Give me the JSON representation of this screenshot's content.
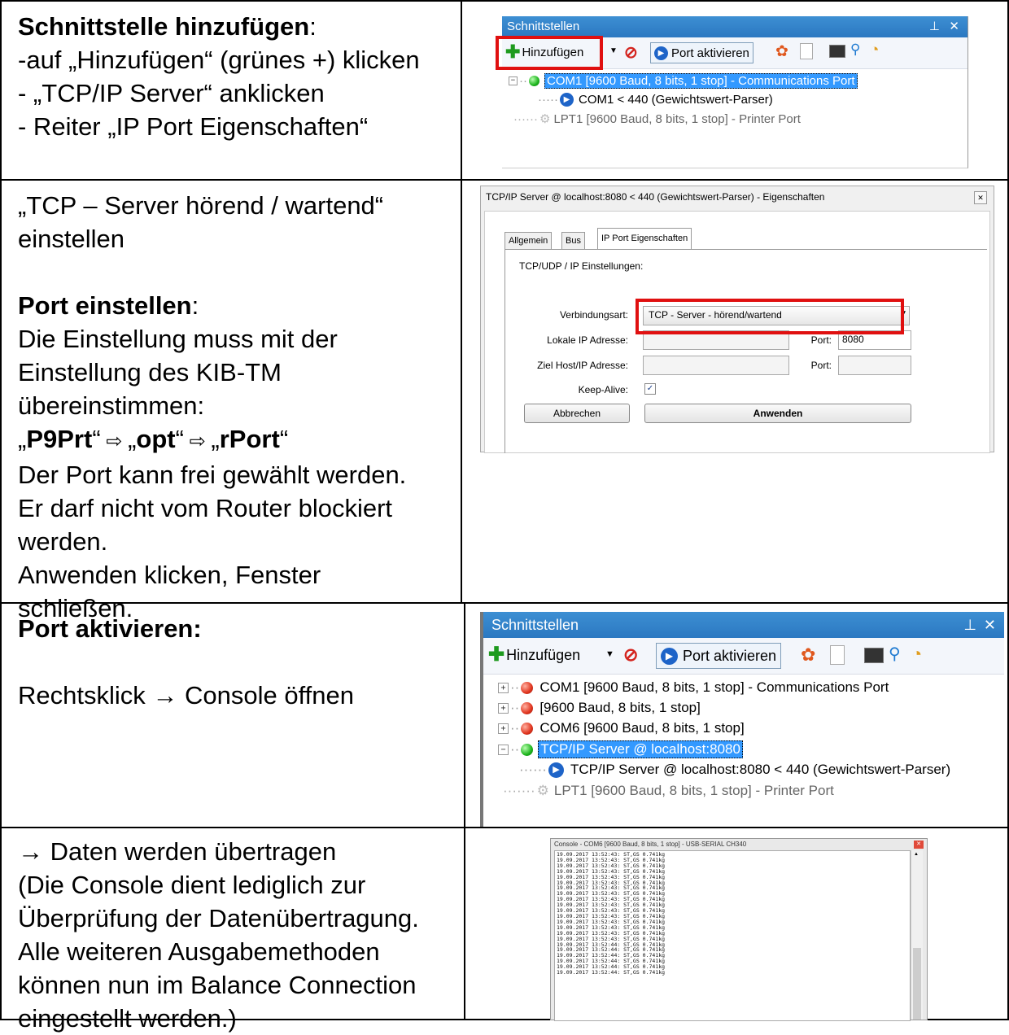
{
  "rows": {
    "r1": {
      "title": "Schnittstelle hinzufügen",
      "title_suffix": ":",
      "lines": [
        "-auf „Hinzufügen“ (grünes +) klicken",
        "- „TCP/IP Server“ anklicken",
        "- Reiter „IP Port Eigenschaften“"
      ]
    },
    "r2": {
      "intro1": "„TCP – Server hörend / wartend“",
      "intro2": "einstellen",
      "title": "Port einstellen",
      "title_suffix": ":",
      "p1": "Die Einstellung muss mit der",
      "p2": "Einstellung des KIB-TM",
      "p3": "übereinstimmen:",
      "path": {
        "a": "P9Prt",
        "b": "opt",
        "c": "rPort",
        "q_open": "„",
        "q_close": "“",
        "arrow": " ⇨ "
      },
      "p4": "Der Port kann frei gewählt werden.",
      "p5": "Er darf nicht vom Router blockiert",
      "p6": "werden.",
      "p7": "Anwenden klicken, Fenster",
      "p8": "schließen."
    },
    "r3": {
      "title": "Port aktivieren:",
      "line": "Rechtsklick → Console öffnen"
    },
    "r4": {
      "lines": [
        "→ Daten werden übertragen",
        "(Die Console dient lediglich zur",
        "Überprüfung der Datenübertragung.",
        "Alle weiteren Ausgabemethoden",
        "können nun im Balance Connection",
        "eingestellt werden.)"
      ]
    }
  },
  "panel1": {
    "title": "Schnittstellen",
    "pin": "ᵖ",
    "close": "✕",
    "add": "Hinzufügen",
    "activate": "Port aktivieren",
    "tree": [
      "COM1 [9600 Baud, 8 bits, 1 stop] - Communications Port",
      "COM1 < 440 (Gewichtswert-Parser)",
      "LPT1 [9600 Baud, 8 bits, 1 stop] - Printer Port"
    ]
  },
  "dialog": {
    "title": "TCP/IP Server @ localhost:8080 < 440 (Gewichtswert-Parser) - Eigenschaften",
    "tabs": [
      "Allgemein",
      "Bus",
      "IP Port Eigenschaften"
    ],
    "section": "TCP/UDP / IP Einstellungen:",
    "conn_label": "Verbindungsart:",
    "conn_value": "TCP - Server - hörend/wartend",
    "local_ip_label": "Lokale IP Adresse:",
    "port_label": "Port:",
    "port_value": "8080",
    "target_label": "Ziel Host/IP Adresse:",
    "keepalive_label": "Keep-Alive:",
    "check": "✓",
    "cancel": "Abbrechen",
    "apply": "Anwenden"
  },
  "panel2": {
    "title": "Schnittstellen",
    "pin": "ᵖ",
    "close": "✕",
    "add": "Hinzufügen",
    "activate": "Port aktivieren",
    "tree": [
      "COM1 [9600 Baud, 8 bits, 1 stop] - Communications Port",
      "[9600 Baud, 8 bits, 1 stop]",
      "COM6 [9600 Baud, 8 bits, 1 stop]",
      "TCP/IP Server @ localhost:8080",
      "TCP/IP Server @ localhost:8080 < 440 (Gewichtswert-Parser)",
      "LPT1 [9600 Baud, 8 bits, 1 stop] - Printer Port"
    ]
  },
  "console": {
    "title": "Console - COM6 [9600 Baud, 8 bits, 1 stop] - USB-SERIAL CH340",
    "lines": [
      "19.09.2017 13:52:43: ST,GS 0.741kg",
      "19.09.2017 13:52:43: ST,GS 0.741kg",
      "19.09.2017 13:52:43: ST,GS 0.741kg",
      "19.09.2017 13:52:43: ST,GS 0.741kg",
      "19.09.2017 13:52:43: ST,GS 0.741kg",
      "19.09.2017 13:52:43: ST,GS 0.741kg",
      "19.09.2017 13:52:43: ST,GS 0.741kg",
      "19.09.2017 13:52:43: ST,GS 0.741kg",
      "19.09.2017 13:52:43: ST,GS 0.741kg",
      "19.09.2017 13:52:43: ST,GS 0.741kg",
      "19.09.2017 13:52:43: ST,GS 0.741kg",
      "19.09.2017 13:52:43: ST,GS 0.741kg",
      "19.09.2017 13:52:43: ST,GS 0.741kg",
      "19.09.2017 13:52:43: ST,GS 0.741kg",
      "19.09.2017 13:52:43: ST,GS 0.741kg",
      "19.09.2017 13:52:43: ST,GS 0.741kg",
      "19.09.2017 13:52:44: ST,GS 0.741kg",
      "19.09.2017 13:52:44: ST,GS 0.741kg",
      "19.09.2017 13:52:44: ST,GS 0.741kg",
      "19.09.2017 13:52:44: ST,GS 0.741kg",
      "19.09.2017 13:52:44: ST,GS 0.741kg",
      "19.09.2017 13:52:44: ST,GS 0.741kg"
    ]
  }
}
